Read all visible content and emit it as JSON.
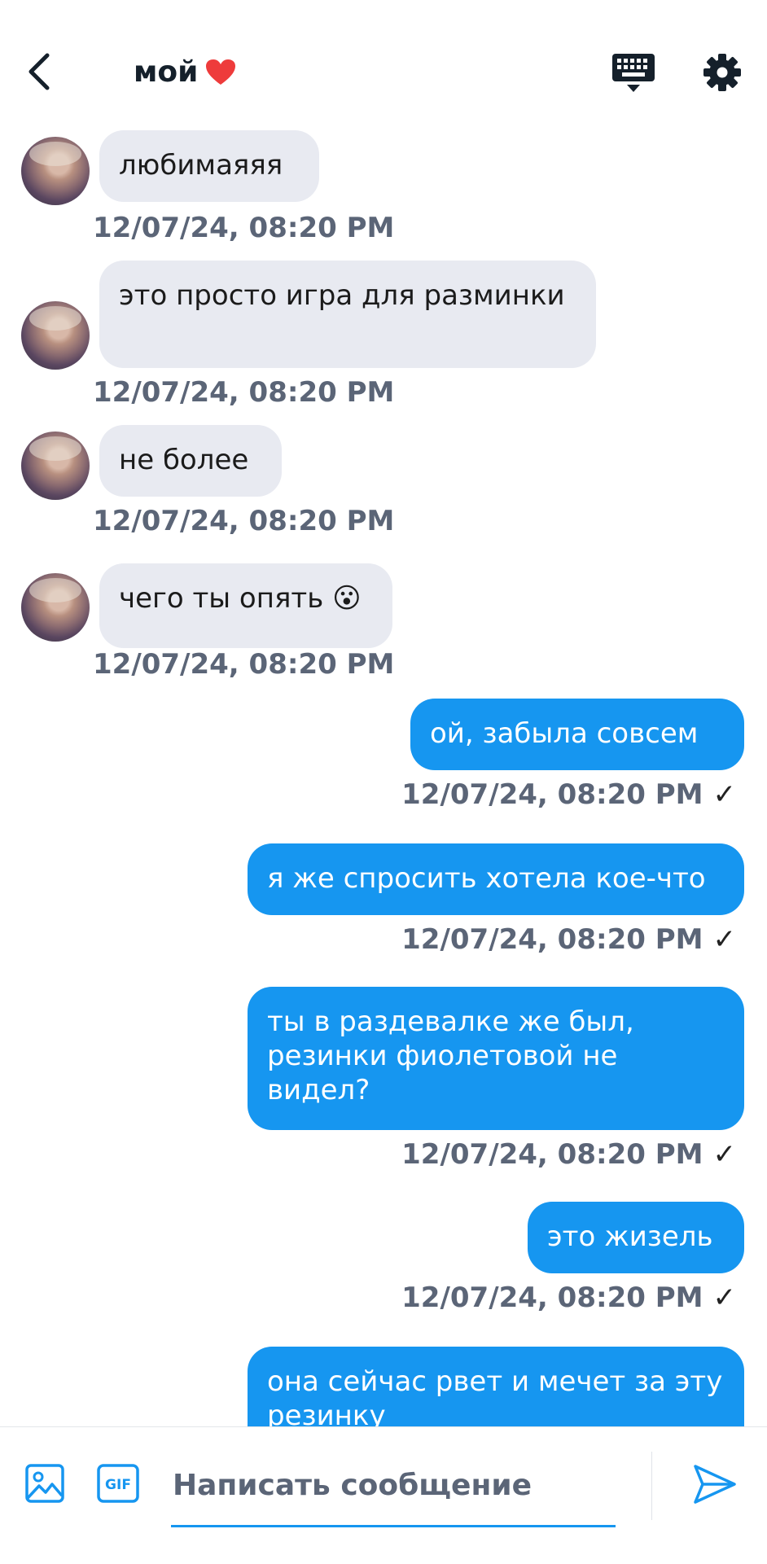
{
  "header": {
    "title": "мой",
    "back_icon": "chevron-left-icon",
    "keyboard_icon": "keyboard-icon",
    "settings_icon": "gear-icon"
  },
  "messages": [
    {
      "dir": "in",
      "text": "любимаяяя",
      "time": "12/07/24, 08:20 PM"
    },
    {
      "dir": "in",
      "text": "это просто игра для разминки",
      "time": "12/07/24, 08:20 PM"
    },
    {
      "dir": "in",
      "text": "не более",
      "time": "12/07/24, 08:20 PM"
    },
    {
      "dir": "in",
      "text": "чего ты опять",
      "emoji": "😮",
      "time": "12/07/24, 08:20 PM"
    },
    {
      "dir": "out",
      "text": "ой, забыла совсем",
      "time": "12/07/24, 08:20 PM",
      "status": "✓"
    },
    {
      "dir": "out",
      "text": "я же спросить хотела кое-что",
      "time": "12/07/24, 08:20 PM",
      "status": "✓"
    },
    {
      "dir": "out",
      "text": "ты в раздевалке же был, резинки фиолетовой не видел?",
      "time": "12/07/24, 08:20 PM",
      "status": "✓"
    },
    {
      "dir": "out",
      "text": "это жизель",
      "time": "12/07/24, 08:20 PM",
      "status": "✓"
    },
    {
      "dir": "out",
      "text": "она сейчас рвет и мечет за эту резинку",
      "time": "",
      "status": ""
    }
  ],
  "composer": {
    "placeholder": "Написать сообщение",
    "value": "",
    "gif_label": "GIF"
  },
  "colors": {
    "outgoing_bubble": "#1696f0",
    "incoming_bubble": "#e8eaf1",
    "timestamp": "#5b6577",
    "accent": "#1696f0"
  }
}
